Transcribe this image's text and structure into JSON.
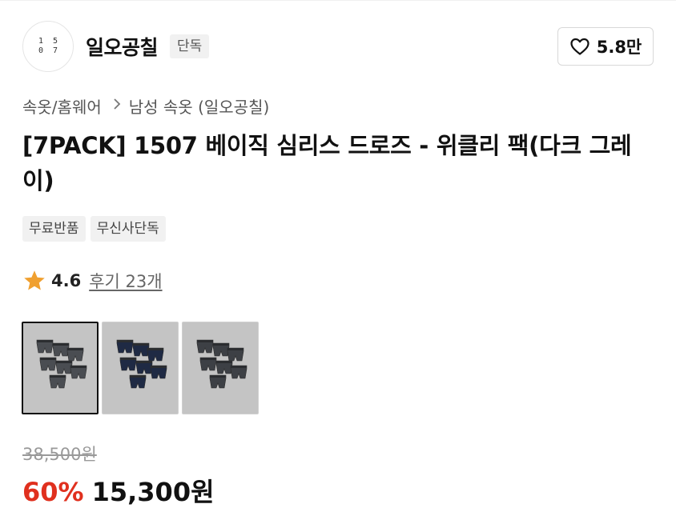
{
  "brand": {
    "logo_line1": "1 5",
    "logo_line2": "0 7",
    "name": "일오공칠",
    "badge": "단독",
    "like_count": "5.8만"
  },
  "breadcrumb": {
    "category": "속옷/홈웨어",
    "subcategory": "남성 속옷 (일오공칠)"
  },
  "product": {
    "title": "[7PACK] 1507 베이직 심리스 드로즈 - 위클리 팩(다크 그레이)",
    "tags": [
      "무료반품",
      "무신사단독"
    ],
    "rating": "4.6",
    "reviews": "후기 23개",
    "original_price": "38,500원",
    "discount": "60%",
    "price": "15,300원"
  },
  "thumbnails": [
    {
      "color": "#4a4d52",
      "selected": true
    },
    {
      "color": "#1f2a44",
      "selected": false
    },
    {
      "color": "#3d4045",
      "selected": false
    }
  ],
  "colors": {
    "accent_discount": "#e0301e",
    "star": "#f0a030"
  },
  "icons": [
    "heart-icon",
    "star-icon",
    "chevron-right-icon"
  ]
}
